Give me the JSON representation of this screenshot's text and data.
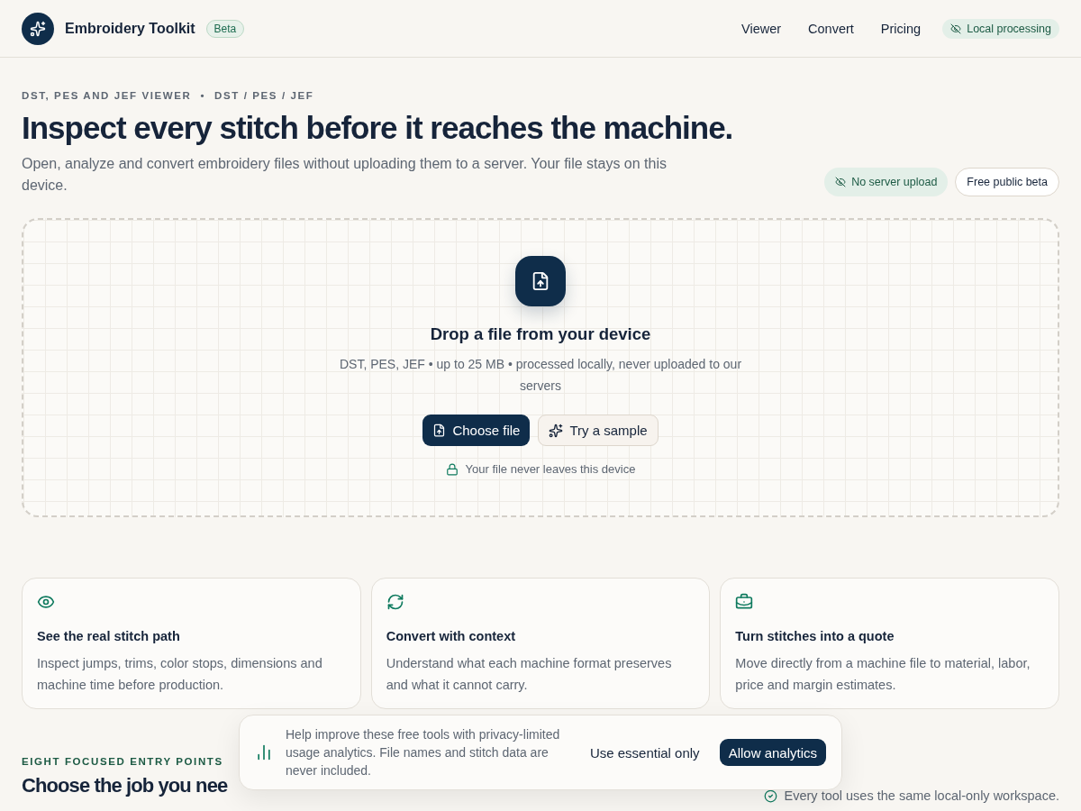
{
  "brand": {
    "name": "Embroidery Toolkit",
    "badge": "Beta"
  },
  "nav": [
    {
      "label": "Viewer"
    },
    {
      "label": "Convert"
    },
    {
      "label": "Pricing"
    }
  ],
  "status_pill": "Local processing",
  "hero": {
    "eyebrow": "DST, PES AND JEF VIEWER",
    "eyebrow_sep": "•",
    "eyebrow_formats": "DST / PES / JEF",
    "title": "Inspect every stitch before it reaches the machine.",
    "lead": "Open, analyze and convert embroidery files without uploading them to a server. Your file stays on this device.",
    "pills": [
      {
        "label": "No server upload",
        "kind": "privacy"
      },
      {
        "label": "Free public beta",
        "kind": "plain"
      }
    ]
  },
  "dropzone": {
    "title": "Drop a file from your device",
    "hint": "DST, PES, JEF • up to 25 MB • processed locally, never uploaded to our servers",
    "primary": "Choose file",
    "secondary": "Try a sample",
    "note": "Your file never leaves this device"
  },
  "features": [
    {
      "kind": "eye",
      "title": "See the real stitch path",
      "text": "Inspect jumps, trims, color stops, dimensions and machine time before production."
    },
    {
      "kind": "refresh",
      "title": "Convert with context",
      "text": "Understand what each machine format preserves and what it cannot carry."
    },
    {
      "kind": "briefcase",
      "title": "Turn stitches into a quote",
      "text": "Move directly from a machine file to material, labor, price and margin estimates."
    }
  ],
  "section": {
    "eyebrow": "EIGHT FOCUSED ENTRY POINTS",
    "title": "Choose the job you nee",
    "note": "Every tool uses the same local-only workspace."
  },
  "consent": {
    "text": "Help improve these free tools with privacy-limited usage analytics. File names and stitch data are never included.",
    "decline": "Use essential only",
    "accept": "Allow analytics"
  }
}
